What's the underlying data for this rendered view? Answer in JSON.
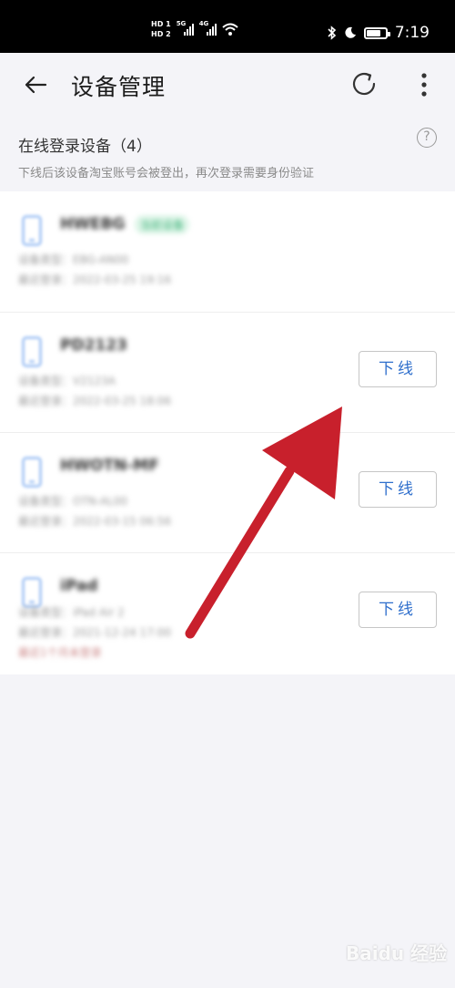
{
  "status_bar": {
    "hd1": "HD 1",
    "hd2": "HD 2",
    "net1": "5G",
    "net2": "4G",
    "time": "7:19",
    "battery_level": 0.8
  },
  "app_bar": {
    "title": "设备管理"
  },
  "section": {
    "title": "在线登录设备（4）",
    "subtitle": "下线后该设备淘宝账号会被登出，再次登录需要身份验证"
  },
  "devices": [
    {
      "name": "HWEBG",
      "badge": "当前设备",
      "line1": "设备类型：EBG-AN00",
      "line2": "最近登录：2022-03-25 19:16"
    },
    {
      "name": "PD2123",
      "line1": "设备类型：V2123A",
      "line2": "最近登录：2022-03-25 18:06",
      "button": "下线"
    },
    {
      "name": "HWOTN-MF",
      "line1": "设备类型：OTN-AL00",
      "line2": "最近登录：2022-03-15 06:56",
      "button": "下线"
    },
    {
      "name": "iPad",
      "line1": "设备类型：iPad Air 2",
      "line2": "最近登录：2021-12-24 17:00",
      "line3": "最近1个月未登录",
      "button": "下线"
    }
  ],
  "watermark": "Baidu 经验",
  "colors": {
    "accent_blue": "#2f6fcc",
    "arrow_red": "#c8202c",
    "background": "#f4f4f8"
  }
}
